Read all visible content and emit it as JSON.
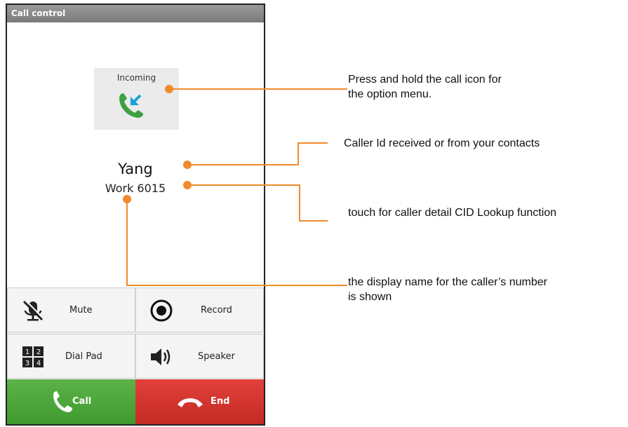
{
  "window": {
    "title": "Call control"
  },
  "call": {
    "status": "Incoming",
    "caller_name": "Yang",
    "caller_detail": "Work 6015"
  },
  "controls": {
    "mute": "Mute",
    "record": "Record",
    "dialpad": "Dial Pad",
    "speaker": "Speaker",
    "dialpad_keys": [
      "1",
      "2",
      "3",
      "4"
    ],
    "call": "Call",
    "end": "End"
  },
  "annotations": {
    "call_icon_line1": "Press and hold the call icon for",
    "call_icon_line2": "the option menu.",
    "caller_id": "Caller Id received or from your contacts",
    "caller_detail": "touch for caller detail CID Lookup function",
    "display_name_line1": "the display name for the caller’s number",
    "display_name_line2": "is shown"
  },
  "colors": {
    "accent_orange": "#f08a2c",
    "call_green": "#4caa3c",
    "end_red": "#d2332d",
    "incoming_arrow": "#1aa0d8"
  }
}
